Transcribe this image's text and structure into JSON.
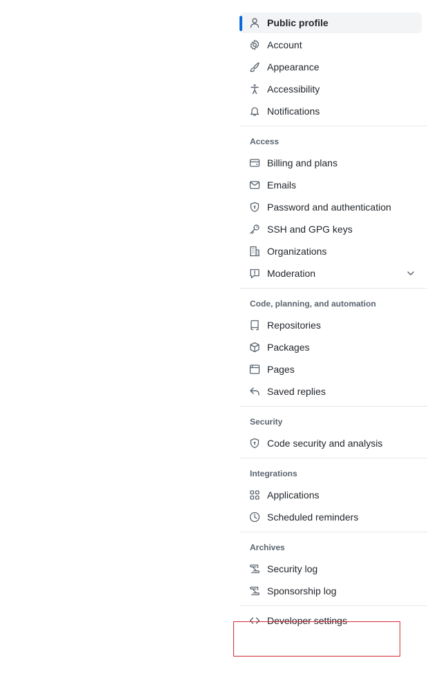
{
  "nav": {
    "top": [
      {
        "label": "Public profile",
        "icon": "person-icon"
      },
      {
        "label": "Account",
        "icon": "gear-icon"
      },
      {
        "label": "Appearance",
        "icon": "paintbrush-icon"
      },
      {
        "label": "Accessibility",
        "icon": "accessibility-icon"
      },
      {
        "label": "Notifications",
        "icon": "bell-icon"
      }
    ],
    "access": {
      "heading": "Access",
      "items": [
        {
          "label": "Billing and plans",
          "icon": "credit-card-icon"
        },
        {
          "label": "Emails",
          "icon": "mail-icon"
        },
        {
          "label": "Password and authentication",
          "icon": "shield-lock-icon"
        },
        {
          "label": "SSH and GPG keys",
          "icon": "key-icon"
        },
        {
          "label": "Organizations",
          "icon": "organization-icon"
        },
        {
          "label": "Moderation",
          "icon": "report-icon"
        }
      ]
    },
    "code": {
      "heading": "Code, planning, and automation",
      "items": [
        {
          "label": "Repositories",
          "icon": "repo-icon"
        },
        {
          "label": "Packages",
          "icon": "package-icon"
        },
        {
          "label": "Pages",
          "icon": "browser-icon"
        },
        {
          "label": "Saved replies",
          "icon": "reply-icon"
        }
      ]
    },
    "security": {
      "heading": "Security",
      "items": [
        {
          "label": "Code security and analysis",
          "icon": "shield-lock-icon"
        }
      ]
    },
    "integrations": {
      "heading": "Integrations",
      "items": [
        {
          "label": "Applications",
          "icon": "apps-icon"
        },
        {
          "label": "Scheduled reminders",
          "icon": "clock-icon"
        }
      ]
    },
    "archives": {
      "heading": "Archives",
      "items": [
        {
          "label": "Security log",
          "icon": "log-icon"
        },
        {
          "label": "Sponsorship log",
          "icon": "log-icon"
        }
      ]
    },
    "developer": {
      "label": "Developer settings",
      "icon": "code-icon"
    }
  },
  "colors": {
    "accent": "#0969da",
    "highlight": "#d42a35",
    "active_bg": "#f3f4f6"
  }
}
